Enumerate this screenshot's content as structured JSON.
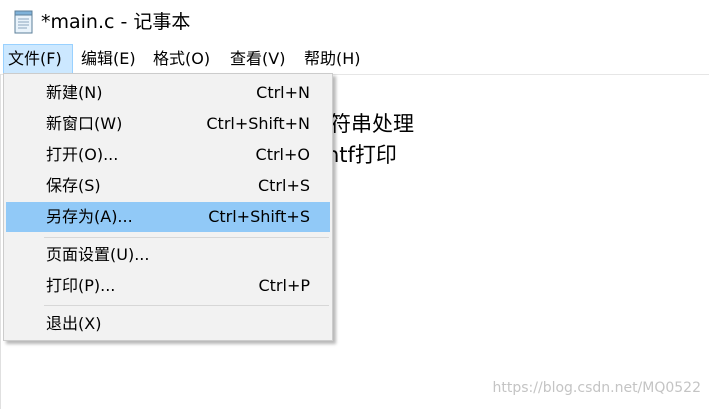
{
  "window": {
    "title": "*main.c - 记事本",
    "icon": "notepad-icon"
  },
  "menubar": {
    "items": [
      {
        "label": "文件(F)",
        "active": true
      },
      {
        "label": "编辑(E)",
        "active": false
      },
      {
        "label": "格式(O)",
        "active": false
      },
      {
        "label": "查看(V)",
        "active": false
      },
      {
        "label": "帮助(H)",
        "active": false
      }
    ]
  },
  "editor": {
    "lines": [
      "符串处理",
      "ntf打印"
    ]
  },
  "file_menu": {
    "items": [
      {
        "label": "新建(N)",
        "shortcut": "Ctrl+N"
      },
      {
        "label": "新窗口(W)",
        "shortcut": "Ctrl+Shift+N"
      },
      {
        "label": "打开(O)...",
        "shortcut": "Ctrl+O"
      },
      {
        "label": "保存(S)",
        "shortcut": "Ctrl+S"
      },
      {
        "label": "另存为(A)...",
        "shortcut": "Ctrl+Shift+S",
        "highlighted": true
      },
      {
        "label": "页面设置(U)...",
        "shortcut": ""
      },
      {
        "label": "打印(P)...",
        "shortcut": "Ctrl+P"
      },
      {
        "label": "退出(X)",
        "shortcut": ""
      }
    ]
  },
  "watermark": "https://blog.csdn.net/MQ0522",
  "colors": {
    "menu_active_bg": "#cce8ff",
    "menu_item_highlight": "#91c9f7",
    "dropdown_bg": "#f2f2f2"
  }
}
